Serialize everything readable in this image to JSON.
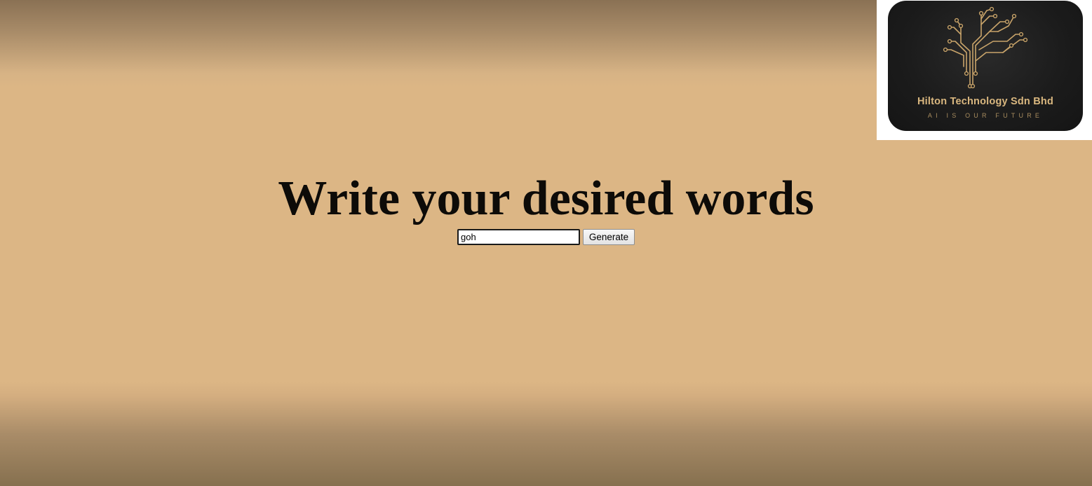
{
  "logo": {
    "company_name": "Hilton Technology Sdn Bhd",
    "tagline": "AI IS OUR FUTURE",
    "icon": "circuit-tree-icon",
    "text_color": "#d9b77f",
    "card_color": "#1b1b1b"
  },
  "main": {
    "title": "Write your desired words",
    "input_value": "goh",
    "generate_label": "Generate"
  },
  "colors": {
    "background": "#dcb685",
    "title": "#0d0b08"
  }
}
